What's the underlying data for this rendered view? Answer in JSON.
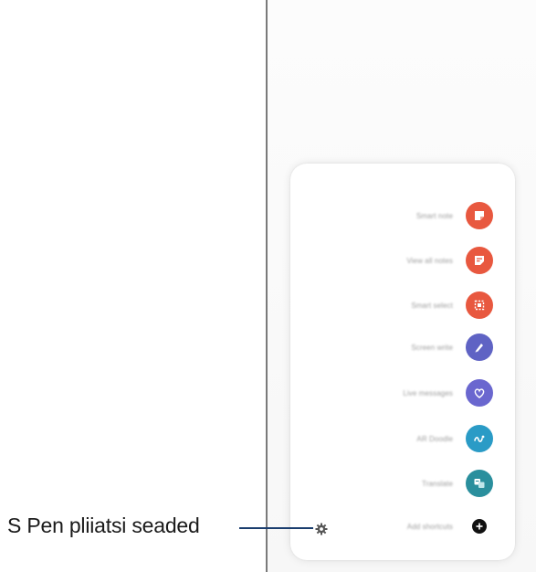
{
  "callout": {
    "label": "S Pen pliiatsi seaded"
  },
  "air_menu": {
    "items": [
      {
        "label": "Smart note",
        "icon": "create-note-icon",
        "color": "#e8583f"
      },
      {
        "label": "View all notes",
        "icon": "view-notes-icon",
        "color": "#e8583f"
      },
      {
        "label": "Smart select",
        "icon": "smart-select-icon",
        "color": "#e8583f"
      },
      {
        "label": "Screen write",
        "icon": "screen-write-icon",
        "color": "#5f63c4"
      },
      {
        "label": "Live messages",
        "icon": "live-messages-icon",
        "color": "#6a67cf"
      },
      {
        "label": "AR Doodle",
        "icon": "ar-doodle-icon",
        "color": "#2a9bc6"
      },
      {
        "label": "Translate",
        "icon": "translate-icon",
        "color": "#2a8f9d"
      }
    ],
    "add_label": "Add shortcuts",
    "add_icon": "add-icon",
    "settings_icon": "gear-icon"
  }
}
